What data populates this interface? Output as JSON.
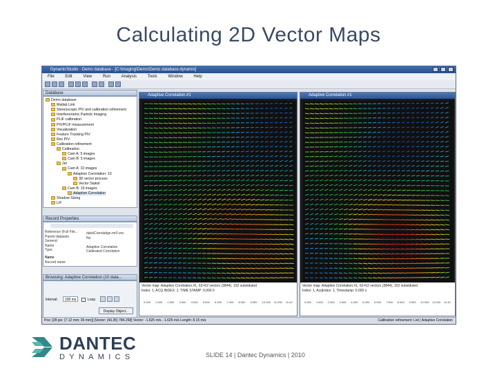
{
  "slide": {
    "title": "Calculating 2D Vector Maps",
    "footer": "SLIDE 14 | Dantec Dynamics | 2010",
    "brand_name": "DANTEC",
    "brand_sub": "DYNAMICS"
  },
  "app": {
    "window_title": "DynamicStudio - Demo database - [C:\\Imaging\\Demo\\Demo database.dynamix]",
    "menu": [
      "File",
      "Edit",
      "View",
      "Run",
      "Analysis",
      "Tools",
      "Window",
      "Help"
    ],
    "database_panel": {
      "title": "Database",
      "items": [
        {
          "label": "Demo database",
          "level": 0
        },
        {
          "label": "Matlab Link",
          "level": 1
        },
        {
          "label": "Stereoscopic PIV and calibration refinement",
          "level": 1
        },
        {
          "label": "Interferometric Particle Imaging",
          "level": 1
        },
        {
          "label": "PLIF calibration",
          "level": 1
        },
        {
          "label": "PIV/PLIF measurement",
          "level": 1
        },
        {
          "label": "Visualization",
          "level": 1
        },
        {
          "label": "Feature Tracking PIV",
          "level": 1
        },
        {
          "label": "Rec PIV",
          "level": 1
        },
        {
          "label": "Calibration refinement",
          "level": 1
        },
        {
          "label": "Calibration",
          "level": 2
        },
        {
          "label": "Cam A: 5 images",
          "level": 3
        },
        {
          "label": "Cam B: 5 images",
          "level": 3
        },
        {
          "label": "Jet",
          "level": 2
        },
        {
          "label": "Cam A: 10 images",
          "level": 3
        },
        {
          "label": "Adaptive Correlation: 10",
          "level": 4
        },
        {
          "label": "3D vector process",
          "level": 5
        },
        {
          "label": "Vector Statist",
          "level": 5
        },
        {
          "label": "Cam B: 10 images",
          "level": 3
        },
        {
          "label": "Adaptive Correlation",
          "level": 4,
          "selected": true
        },
        {
          "label": "Shadow Sizing",
          "level": 1
        },
        {
          "label": "LIF",
          "level": 1
        }
      ]
    },
    "record_properties": {
      "title": "Record Properties",
      "rows": [
        {
          "key": "Reference (Full File...",
          "value": "data\\Correlatign.mr0.vec"
        },
        {
          "key": "Parent datasets",
          "value": "No"
        },
        {
          "key": "General",
          "value": ""
        },
        {
          "key": "Name",
          "value": "Adaptive Correlation"
        },
        {
          "key": "Type",
          "value": "Calibrated Correlation"
        }
      ],
      "section": "Name",
      "section_desc": "Record name"
    },
    "browse_panel": {
      "title": "Browsing: Adaptive Correlation (10 data...",
      "interval_label": "Interval:",
      "interval_value": "100 ms",
      "loop_label": "Loop",
      "display_button": "Display Object..."
    },
    "windows": [
      {
        "title": "Adaptive Correlation.#1",
        "info_line1": "Vector map: Adaptive Correlation.#1, 62×62 vectors (3844), 152 substituted",
        "info_line2": "Index: 1, ACQ INDEX: 1, TIME STAMP: 0.000 0",
        "ticks": [
          "0.000",
          "1.000",
          "2.000",
          "3.000",
          "4.000",
          "5.000",
          "6.000",
          "7.000",
          "8.000",
          "9.000",
          "10.000",
          "11.000",
          "11.42"
        ]
      },
      {
        "title": "Adaptive Correlation.#1",
        "info_line1": "Vector map: Adaptive Correlation.#1, 62×62 vectors (3844), 152 substituted",
        "info_line2": "Index: 1, AcqIndex: 1, Timestamp: 0.000 s",
        "ticks": [
          "0.000",
          "1.000",
          "2.000",
          "3.000",
          "4.000",
          "5.000",
          "6.000",
          "7.000",
          "8.000",
          "9.000",
          "10.000",
          "11.000",
          "11.42"
        ]
      }
    ],
    "status_bar": "Pos: [28 pix: (7.12 mm; 36 mm)] [Vector: (43.35) 784.258] Vector: -1.625 m/s, -1.625 m/s Length: 8.15 m/s",
    "status_right": "Calibration refinement: List | Adaptive Correlation"
  }
}
